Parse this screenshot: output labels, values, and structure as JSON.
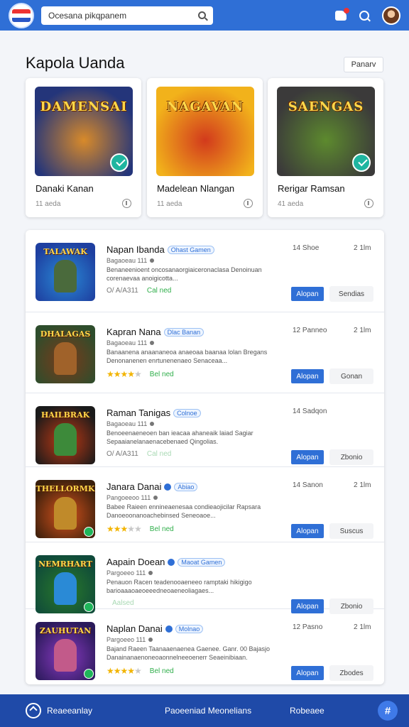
{
  "header": {
    "search_value": "Ocesana pikqpanem",
    "notifications_dot": true
  },
  "page": {
    "title": "Kapola Uanda",
    "filter_label": "Panarv"
  },
  "featured": [
    {
      "art_title": "DAMENSAI",
      "name": "Danaki Kanan",
      "meta": "11 aeda",
      "colors": [
        "#24357a",
        "#d88a2a"
      ]
    },
    {
      "art_title": "NAGAVAN",
      "name": "Madelean Nlangan",
      "meta": "11 aeda",
      "colors": [
        "#f2b21b",
        "#d23a1c"
      ]
    },
    {
      "art_title": "SAENGAS",
      "name": "Rerigar Ramsan",
      "meta": "41 aeda",
      "colors": [
        "#3b3a3a",
        "#5d8a2e"
      ]
    }
  ],
  "list": [
    {
      "title": "Napan Ibanda",
      "tag": "Ohast Gamen",
      "verified": false,
      "sub": "Bagaoeau 111",
      "desc": "Benaneenioent oncosanaorgiaiceronaclasa Denoinuan corenaevaa anoigicotta...",
      "rating_text": "O/ A/A311",
      "stars": 0,
      "ok": "Cal ned",
      "ok_faint": false,
      "stat_a": "14 Shoe",
      "stat_b": "2 1lm",
      "primary": "Alopan",
      "secondary": "Sendias",
      "thumb_title": "TALAWAK",
      "colors": [
        "#1e3fa0",
        "#2a8ad6"
      ],
      "fig": "#4a6a3c"
    },
    {
      "title": "Kapran Nana",
      "tag": "Dlac Banan",
      "verified": false,
      "sub": "Bagaoeau 111",
      "desc": "Banaanena anaananeoa anaeoaa baanaa lolan Bregans Denonanenen enrtunenenaeo Senaceaa...",
      "rating_text": "",
      "stars": 4,
      "ok": "Bel ned",
      "ok_faint": false,
      "stat_a": "12 Panneo",
      "stat_b": "2 1lm",
      "primary": "Alopan",
      "secondary": "Gonan",
      "thumb_title": "DHALAGAS",
      "colors": [
        "#2e4d2c",
        "#7a3a1a"
      ],
      "fig": "#a0622a"
    },
    {
      "title": "Raman Tanigas",
      "tag": "Colnoe",
      "verified": false,
      "sub": "Bagaoeau 111",
      "desc": "Benoeenaeneoen ban ieacaa ahaneaik laiad Sagiar Sepaaianelanaenacebenaed Qingolias.",
      "rating_text": "O/ A/A311",
      "stars": 0,
      "ok": "Cal ned",
      "ok_faint": true,
      "stat_a": "14 Sadqon",
      "stat_b": "",
      "primary": "Alopan",
      "secondary": "Zbonio",
      "thumb_title": "HAILBRAK",
      "colors": [
        "#1a1a1a",
        "#c23a14"
      ],
      "fig": "#3d8a3a"
    },
    {
      "title": "Janara Danai",
      "tag": "Abiao",
      "verified": true,
      "sub": "Pangoeeoo 111",
      "desc": "Babee Raieen ennineaenesaa condieaojicilar Rapsara Danoeoonanoachebinsed Seneoaoe...",
      "rating_text": "",
      "stars": 3,
      "ok": "Bel ned",
      "ok_faint": false,
      "stat_a": "14 Sanon",
      "stat_b": "2 1lm",
      "primary": "Alopan",
      "secondary": "Suscus",
      "thumb_title": "THELLORMK",
      "colors": [
        "#3a1f0c",
        "#d8531c"
      ],
      "fig": "#c08a2a"
    },
    {
      "title": "Aapain Doean",
      "tag": "Maoat Gamen",
      "verified": true,
      "sub": "Pargoeeo 111",
      "desc": "Penauon Racen teadenooaeneeo ramptaki hikigigo barioaaaoaeoeeedneoaeneoliagaes...",
      "rating_text": "",
      "stars": 0,
      "ok": "Aalsed",
      "ok_faint": true,
      "stat_a": "",
      "stat_b": "",
      "primary": "Alopan",
      "secondary": "Zbonio",
      "thumb_title": "NEMRHART",
      "colors": [
        "#0f4a3a",
        "#2a7a2a"
      ],
      "fig": "#2a8ad6"
    },
    {
      "title": "Naplan Danai",
      "tag": "Molnao",
      "verified": true,
      "sub": "Pargoeeo 111",
      "desc": "Bajand Raeen Taanaaenaenea Gaenee. Ganr. 00 Bajasjo Danainanaenoneoaonnelneeoenerr Seaeinibiaan.",
      "rating_text": "",
      "stars": 4,
      "ok": "Bel ned",
      "ok_faint": false,
      "stat_a": "12 Pasno",
      "stat_b": "2 1lm",
      "primary": "Alopan",
      "secondary": "Zbodes",
      "thumb_title": "ZAUHUTAN",
      "colors": [
        "#2a1a5a",
        "#8a3ac2"
      ],
      "fig": "#c25a8a"
    }
  ],
  "bottom": {
    "brand": "Reaeeanlay",
    "link1": "Paoeeniad Meonelians",
    "link2": "Robeaee",
    "fab_label": "#"
  }
}
